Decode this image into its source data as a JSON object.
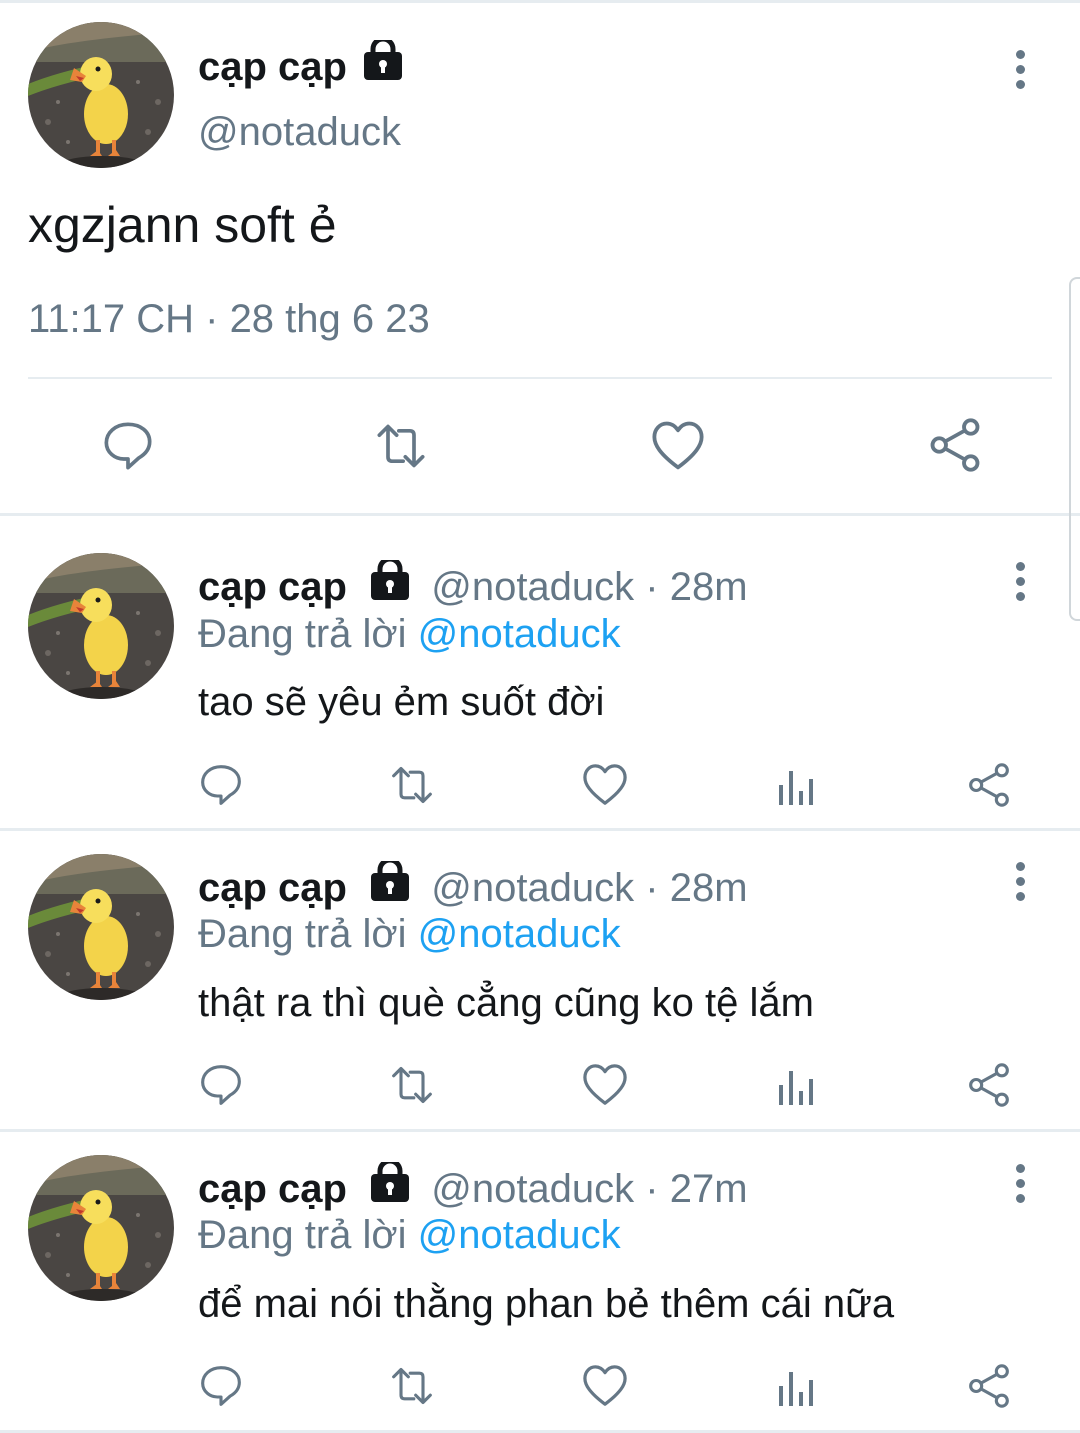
{
  "main_tweet": {
    "name": "cạp cạp",
    "handle": "@notaduck",
    "text": "xgzjann soft ẻ",
    "timestamp": "11:17 CH · 28 thg 6 23",
    "actions": [
      "reply-icon",
      "retweet-icon",
      "like-icon",
      "share-icon"
    ]
  },
  "replies": [
    {
      "name": "cạp cạp",
      "handle": "@notaduck",
      "separator": "·",
      "time": "28m",
      "replying_label": "Đang trả lời",
      "replying_to": "@notaduck",
      "text": "tao sẽ yêu ẻm suốt đời"
    },
    {
      "name": "cạp cạp",
      "handle": "@notaduck",
      "separator": "·",
      "time": "28m",
      "replying_label": "Đang trả lời",
      "replying_to": "@notaduck",
      "text": "thật ra thì què cẳng cũng ko tệ lắm"
    },
    {
      "name": "cạp cạp",
      "handle": "@notaduck",
      "separator": "·",
      "time": "27m",
      "replying_label": "Đang trả lời",
      "replying_to": "@notaduck",
      "text": "để mai nói thằng phan bẻ thêm cái nữa"
    }
  ],
  "colors": {
    "text": "#14171a",
    "muted": "#657786",
    "link": "#1da1f2",
    "divider": "#e6ecf0"
  }
}
